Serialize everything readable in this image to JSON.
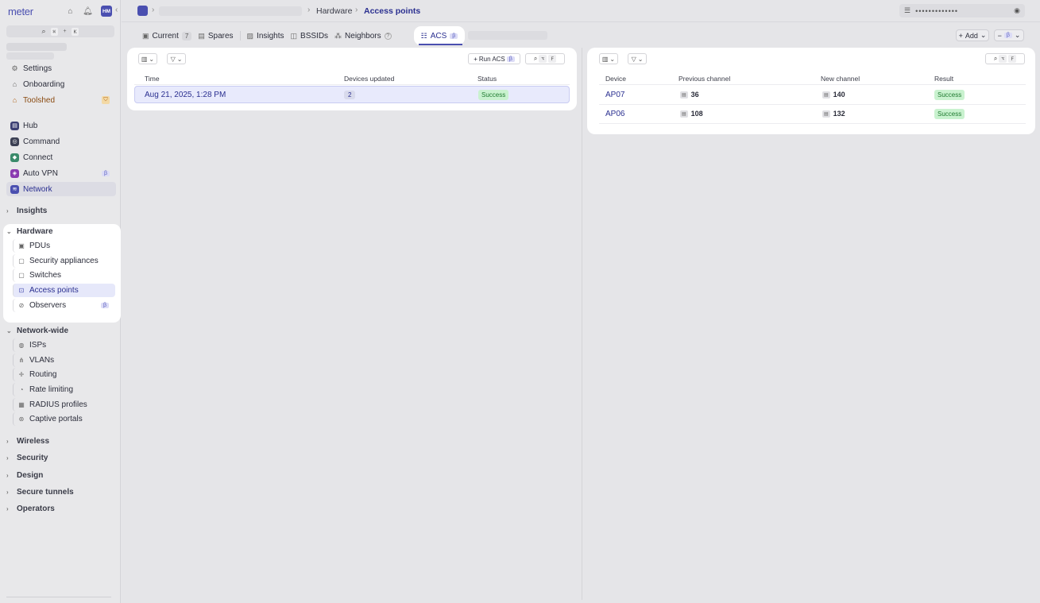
{
  "app": {
    "logo": "meter",
    "avatar": "HM",
    "search_keys": [
      "⌘",
      "K"
    ]
  },
  "sidebar": {
    "top_items": [
      {
        "label": "Settings",
        "icon": "gear-icon"
      },
      {
        "label": "Onboarding",
        "icon": "onboarding-icon"
      },
      {
        "label": "Toolshed",
        "icon": "toolshed-icon"
      }
    ],
    "apps": [
      {
        "label": "Hub",
        "color": "#3b3f73"
      },
      {
        "label": "Command",
        "color": "#3b3f53"
      },
      {
        "label": "Connect",
        "color": "#3a8a6a"
      },
      {
        "label": "Auto VPN",
        "color": "#8a3ab0",
        "beta": "β"
      },
      {
        "label": "Network",
        "color": "#4a4fb0",
        "active": true
      }
    ],
    "groups": {
      "insights": "Insights",
      "hardware": "Hardware",
      "network_wide": "Network-wide",
      "wireless": "Wireless",
      "security": "Security",
      "design": "Design",
      "secure_tunnels": "Secure tunnels",
      "operators": "Operators"
    },
    "hardware_items": [
      {
        "label": "PDUs"
      },
      {
        "label": "Security appliances"
      },
      {
        "label": "Switches"
      },
      {
        "label": "Access points",
        "active": true
      },
      {
        "label": "Observers",
        "beta": "β"
      }
    ],
    "network_wide_items": [
      {
        "label": "ISPs"
      },
      {
        "label": "VLANs"
      },
      {
        "label": "Routing"
      },
      {
        "label": "Rate limiting"
      },
      {
        "label": "RADIUS profiles"
      },
      {
        "label": "Captive portals"
      }
    ]
  },
  "header": {
    "breadcrumb": [
      "Hardware",
      "Access points"
    ],
    "wifi_password": "•••••••••••••"
  },
  "tabs": {
    "current": {
      "label": "Current",
      "count": "7"
    },
    "spares": {
      "label": "Spares"
    },
    "insights": {
      "label": "Insights"
    },
    "bssids": {
      "label": "BSSIDs"
    },
    "neighbors": {
      "label": "Neighbors",
      "badge": "?"
    },
    "acs": {
      "label": "ACS",
      "beta": "β"
    },
    "add_label": "Add",
    "beta": "β"
  },
  "runs": {
    "run_button": "Run ACS",
    "beta": "β",
    "search_keys": [
      "⌥",
      "F"
    ],
    "columns": [
      "Time",
      "Devices updated",
      "Status"
    ],
    "rows": [
      {
        "time": "Aug 21, 2025, 1:28 PM",
        "devices_updated": "2",
        "status": "Success"
      }
    ]
  },
  "results": {
    "search_keys": [
      "⌥",
      "F"
    ],
    "columns": [
      "Device",
      "Previous channel",
      "New channel",
      "Result"
    ],
    "rows": [
      {
        "device": "AP07",
        "previous_channel": "36",
        "new_channel": "140",
        "result": "Success"
      },
      {
        "device": "AP06",
        "previous_channel": "108",
        "new_channel": "132",
        "result": "Success"
      }
    ]
  }
}
